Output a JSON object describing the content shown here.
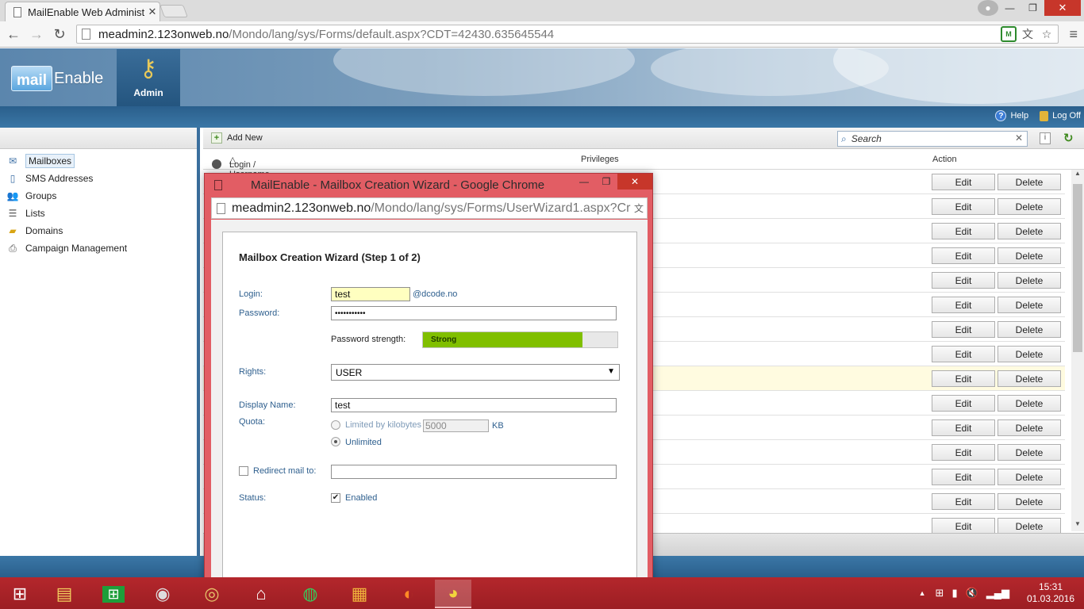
{
  "browser": {
    "tab_title": "MailEnable Web Administr",
    "url_host": "meadmin2.123onweb.no",
    "url_path": "/Mondo/lang/sys/Forms/default.aspx?CDT=42430.635645544"
  },
  "header": {
    "logo_mail": "mail",
    "logo_enable": "Enable",
    "admin_tab": "Admin",
    "help_link": "Help",
    "logoff_link": "Log Off"
  },
  "sidebar": {
    "items": [
      {
        "label": "Mailboxes"
      },
      {
        "label": "SMS Addresses"
      },
      {
        "label": "Groups"
      },
      {
        "label": "Lists"
      },
      {
        "label": "Domains"
      },
      {
        "label": "Campaign Management"
      }
    ]
  },
  "main": {
    "add_new": "Add New",
    "search_placeholder": "Search",
    "columns": {
      "login": "Login / Username",
      "privileges": "Privileges",
      "action": "Action"
    },
    "edit_label": "Edit",
    "delete_label": "Delete",
    "row_count": 15
  },
  "popup": {
    "window_title": "MailEnable - Mailbox Creation Wizard - Google Chrome",
    "url_host": "meadmin2.123onweb.no",
    "url_path": "/Mondo/lang/sys/Forms/UserWizard1.aspx?Cr",
    "form": {
      "title": "Mailbox Creation Wizard (Step 1 of 2)",
      "login_label": "Login:",
      "login_value": "test",
      "domain_suffix": "@dcode.no",
      "password_label": "Password:",
      "password_value": "•••••••••••",
      "strength_label": "Password strength:",
      "strength_text": "Strong",
      "strength_level_pct": 82,
      "rights_label": "Rights:",
      "rights_value": "USER",
      "display_name_label": "Display Name:",
      "display_name_value": "test",
      "quota_label": "Quota:",
      "quota_limited_label": "Limited by kilobytes",
      "quota_value": "5000",
      "quota_unit": "KB",
      "quota_unlimited_label": "Unlimited",
      "redirect_label": "Redirect mail to:",
      "redirect_value": "",
      "status_label": "Status:",
      "status_enabled_label": "Enabled"
    }
  },
  "taskbar": {
    "time": "15:31",
    "date": "01.03.2016"
  }
}
